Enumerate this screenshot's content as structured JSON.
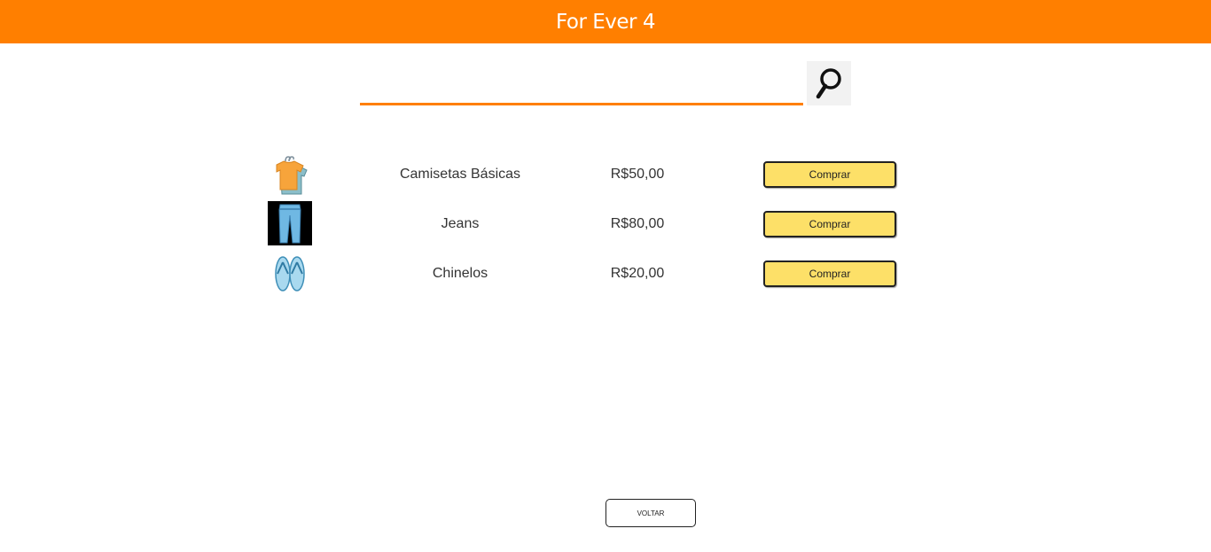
{
  "header": {
    "title": "For Ever 4"
  },
  "search": {
    "value": "",
    "placeholder": "",
    "icon": "magnifier-icon"
  },
  "products": [
    {
      "name": "Camisetas Básicas",
      "price": "R$50,00",
      "buy_label": "Comprar",
      "icon": "tshirt-icon"
    },
    {
      "name": "Jeans",
      "price": "R$80,00",
      "buy_label": "Comprar",
      "icon": "jeans-icon"
    },
    {
      "name": "Chinelos",
      "price": "R$20,00",
      "buy_label": "Comprar",
      "icon": "flip-flops-icon"
    }
  ],
  "footer": {
    "back_label": "VOLTAR"
  },
  "colors": {
    "brand": "#ff7f00",
    "buy_button": "#fde068",
    "text": "#333333"
  }
}
